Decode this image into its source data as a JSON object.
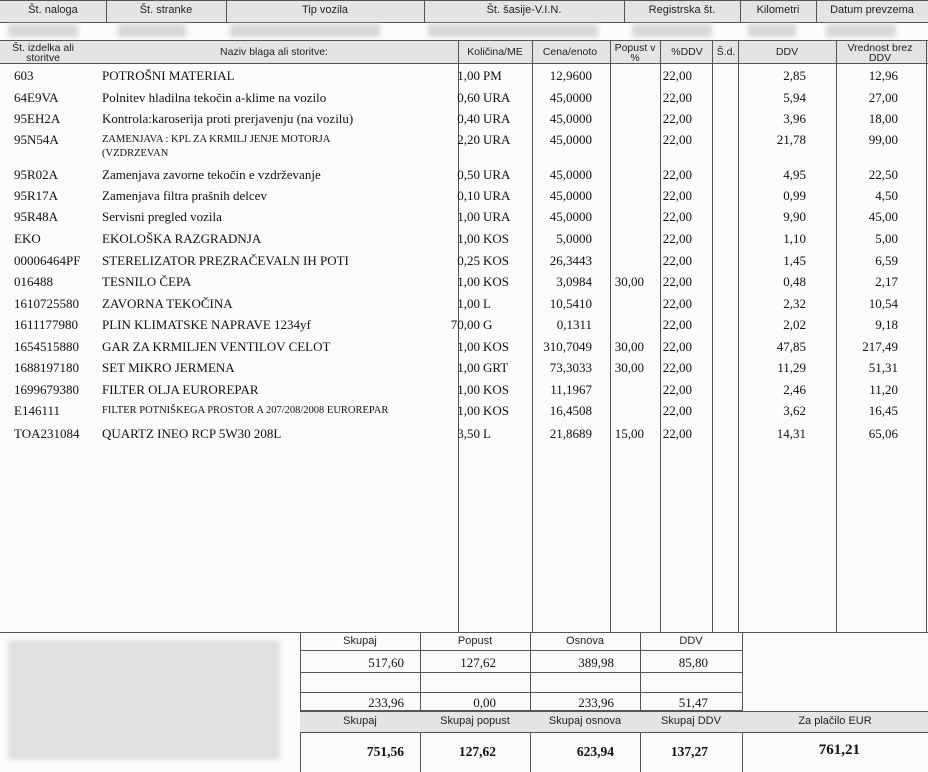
{
  "header": {
    "labels": [
      "Št. naloga",
      "Št. stranke",
      "Tip vozila",
      "Št. šasije-V.I.N.",
      "Registrska št.",
      "Kilometri",
      "Datum prevzema"
    ]
  },
  "columns": {
    "code": "Št. izdelka ali storitve",
    "name": "Naziv blaga ali storitve:",
    "qty": "Količina/ME",
    "price": "Cena/enoto",
    "discount": "Popust v %",
    "vat_pct": "%DDV",
    "sd": "Š.d.",
    "vat": "DDV",
    "value": "Vrednost brez DDV"
  },
  "rows": [
    {
      "code": "603",
      "name": "POTROŠNI MATERIAL",
      "qty": "1,00",
      "unit": "PM",
      "price": "12,9600",
      "discount": "",
      "vat_pct": "22,00",
      "vat": "2,85",
      "value": "12,96"
    },
    {
      "code": "64E9VA",
      "name": "Polnitev hladilna tekočin a-klime na vozilo",
      "qty": "0,60",
      "unit": "URA",
      "price": "45,0000",
      "discount": "",
      "vat_pct": "22,00",
      "vat": "5,94",
      "value": "27,00"
    },
    {
      "code": "95EH2A",
      "name": "Kontrola:karoserija proti prerjavenju (na vozilu)",
      "qty": "0,40",
      "unit": "URA",
      "price": "45,0000",
      "discount": "",
      "vat_pct": "22,00",
      "vat": "3,96",
      "value": "18,00"
    },
    {
      "code": "95N54A",
      "name": "ZAMENJAVA : KPL ZA KRMILJ JENJE MOTORJA",
      "name2": "(VZDRZEVAN",
      "qty": "2,20",
      "unit": "URA",
      "price": "45,0000",
      "discount": "",
      "vat_pct": "22,00",
      "vat": "21,78",
      "value": "99,00"
    },
    {
      "code": "95R02A",
      "name": "Zamenjava zavorne tekočin e vzdrževanje",
      "qty": "0,50",
      "unit": "URA",
      "price": "45,0000",
      "discount": "",
      "vat_pct": "22,00",
      "vat": "4,95",
      "value": "22,50"
    },
    {
      "code": "95R17A",
      "name": "Zamenjava filtra prašnih delcev",
      "qty": "0,10",
      "unit": "URA",
      "price": "45,0000",
      "discount": "",
      "vat_pct": "22,00",
      "vat": "0,99",
      "value": "4,50"
    },
    {
      "code": "95R48A",
      "name": "Servisni pregled vozila",
      "qty": "1,00",
      "unit": "URA",
      "price": "45,0000",
      "discount": "",
      "vat_pct": "22,00",
      "vat": "9,90",
      "value": "45,00"
    },
    {
      "code": "EKO",
      "name": "EKOLOŠKA RAZGRADNJA",
      "qty": "1,00",
      "unit": "KOS",
      "price": "5,0000",
      "discount": "",
      "vat_pct": "22,00",
      "vat": "1,10",
      "value": "5,00"
    },
    {
      "code": "00006464PF",
      "name": "STERELIZATOR PREZRAČEVALN IH POTI",
      "qty": "0,25",
      "unit": "KOS",
      "price": "26,3443",
      "discount": "",
      "vat_pct": "22,00",
      "vat": "1,45",
      "value": "6,59"
    },
    {
      "code": "016488",
      "name": "TESNILO ČEPA",
      "qty": "1,00",
      "unit": "KOS",
      "price": "3,0984",
      "discount": "30,00",
      "vat_pct": "22,00",
      "vat": "0,48",
      "value": "2,17"
    },
    {
      "code": "1610725580",
      "name": "ZAVORNA TEKOČINA",
      "qty": "1,00",
      "unit": "L",
      "price": "10,5410",
      "discount": "",
      "vat_pct": "22,00",
      "vat": "2,32",
      "value": "10,54"
    },
    {
      "code": "1611177980",
      "name": "PLIN KLIMATSKE NAPRAVE 1234yf",
      "qty": "70,00",
      "unit": "G",
      "price": "0,1311",
      "discount": "",
      "vat_pct": "22,00",
      "vat": "2,02",
      "value": "9,18"
    },
    {
      "code": "1654515880",
      "name": "GAR ZA KRMILJEN VENTILOV CELOT",
      "qty": "1,00",
      "unit": "KOS",
      "price": "310,7049",
      "discount": "30,00",
      "vat_pct": "22,00",
      "vat": "47,85",
      "value": "217,49"
    },
    {
      "code": "1688197180",
      "name": "SET MIKRO JERMENA",
      "qty": "1,00",
      "unit": "GRT",
      "price": "73,3033",
      "discount": "30,00",
      "vat_pct": "22,00",
      "vat": "11,29",
      "value": "51,31"
    },
    {
      "code": "1699679380",
      "name": "FILTER OLJA EUROREPAR",
      "qty": "1,00",
      "unit": "KOS",
      "price": "11,1967",
      "discount": "",
      "vat_pct": "22,00",
      "vat": "2,46",
      "value": "11,20"
    },
    {
      "code": "E146111",
      "name": "FILTER POTNIŠKEGA PROSTOR A 207/208/2008 EUROREPAR",
      "qty": "1,00",
      "unit": "KOS",
      "price": "16,4508",
      "discount": "",
      "vat_pct": "22,00",
      "vat": "3,62",
      "value": "16,45"
    },
    {
      "code": "TOA231084",
      "name": "QUARTZ INEO RCP 5W30 208L",
      "qty": "3,50",
      "unit": "L",
      "price": "21,8689",
      "discount": "15,00",
      "vat_pct": "22,00",
      "vat": "14,31",
      "value": "65,06"
    }
  ],
  "totals": {
    "headers": {
      "sum": "Skupaj",
      "discount": "Popust",
      "base": "Osnova",
      "vat": "DDV"
    },
    "line1": {
      "sum": "517,60",
      "discount": "127,62",
      "base": "389,98",
      "vat": "85,80"
    },
    "line2": {
      "sum": "233,96",
      "discount": "0,00",
      "base": "233,96",
      "vat": "51,47"
    },
    "final_headers": {
      "sum": "Skupaj",
      "discount": "Skupaj popust",
      "base": "Skupaj osnova",
      "vat": "Skupaj DDV",
      "pay": "Za plačilo EUR"
    },
    "final": {
      "sum": "751,56",
      "discount": "127,62",
      "base": "623,94",
      "vat": "137,27",
      "pay": "761,21"
    }
  }
}
